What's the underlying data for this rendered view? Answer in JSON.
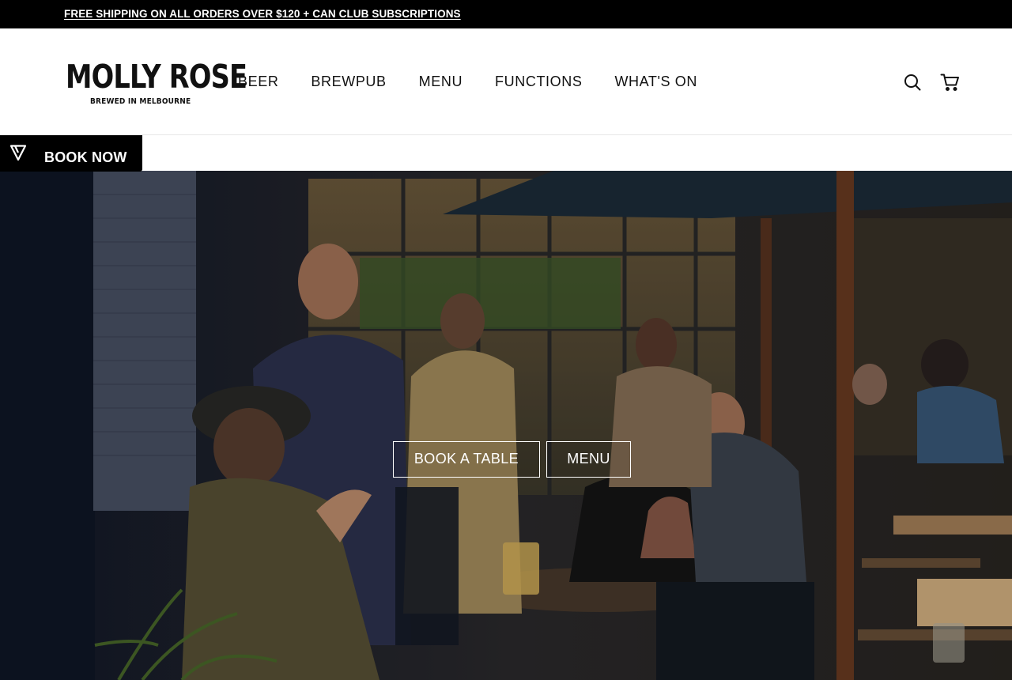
{
  "announcement": {
    "text": "FREE SHIPPING ON ALL ORDERS OVER $120 + CAN CLUB SUBSCRIPTIONS"
  },
  "brand": {
    "name": "MOLLY ROSE",
    "tagline": "BREWED IN MELBOURNE"
  },
  "nav": {
    "items": [
      {
        "label": "BEER"
      },
      {
        "label": "BREWPUB"
      },
      {
        "label": "MENU"
      },
      {
        "label": "FUNCTIONS"
      },
      {
        "label": "WHAT'S ON"
      }
    ]
  },
  "header_icons": {
    "search": "search-icon",
    "cart": "cart-icon"
  },
  "book_now": {
    "label": "BOOK NOW",
    "icon": "triangle-logo-icon"
  },
  "hero": {
    "primary_cta": "BOOK A TABLE",
    "secondary_cta": "MENU"
  },
  "colors": {
    "bar": "#000000",
    "text": "#111111",
    "background": "#ffffff"
  }
}
